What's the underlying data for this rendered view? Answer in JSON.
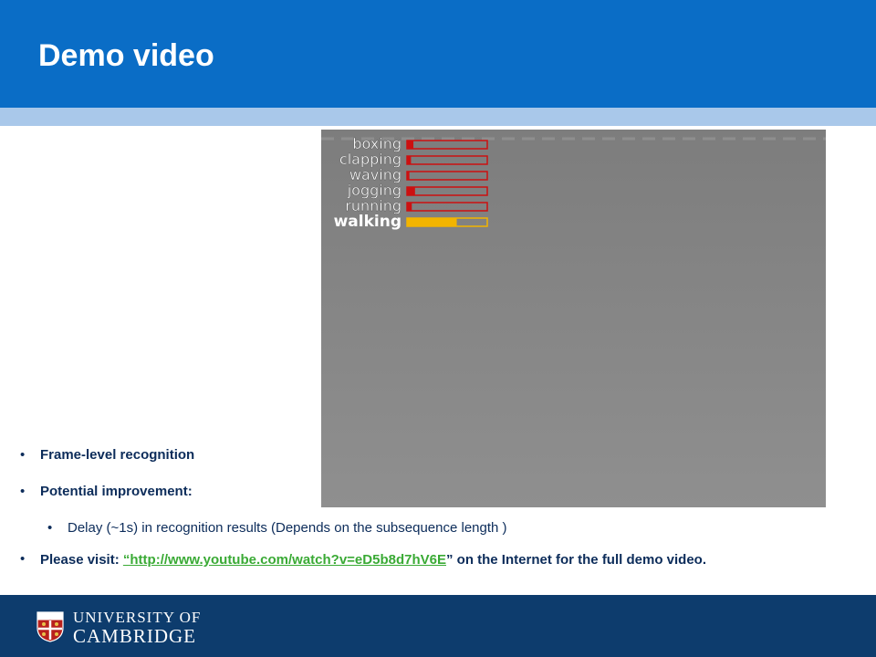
{
  "slide": {
    "title": "Demo video"
  },
  "video": {
    "activities": [
      {
        "label": "boxing",
        "level": 0.08,
        "color": "#cc1010"
      },
      {
        "label": "clapping",
        "level": 0.05,
        "color": "#cc1010"
      },
      {
        "label": "waving",
        "level": 0.03,
        "color": "#cc1010"
      },
      {
        "label": "jogging",
        "level": 0.1,
        "color": "#cc1010"
      },
      {
        "label": "running",
        "level": 0.06,
        "color": "#cc1010"
      },
      {
        "label": "walking",
        "level": 0.62,
        "color": "#f2b400",
        "highlighted": true
      }
    ]
  },
  "bullets": {
    "item1": "Frame-level recognition",
    "item2": "Potential improvement:",
    "sub1": "Delay (~1s) in recognition results (Depends on the subsequence length )",
    "visit_prefix": "Please visit: ",
    "visit_link": "“http://www.youtube.com/watch?v=eD5b8d7hV6E",
    "visit_suffix": "” on the Internet for the full demo video."
  },
  "footer": {
    "logo_line1": "UNIVERSITY OF",
    "logo_line2": "CAMBRIDGE"
  },
  "colors": {
    "header": "#0a6dc6",
    "header_stripe": "#a9c8ea",
    "footer": "#0d3c6d",
    "text": "#0c2c5a",
    "link": "#3aaa35"
  }
}
